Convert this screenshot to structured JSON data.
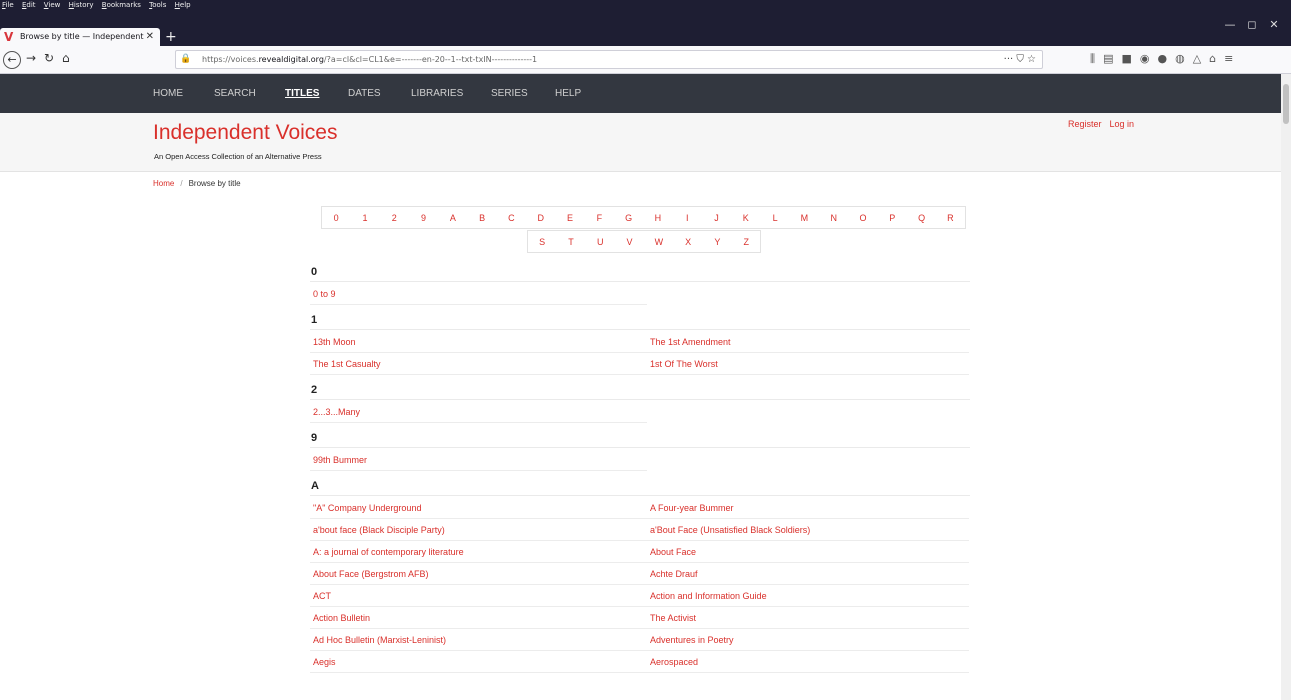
{
  "browser": {
    "menu": [
      "File",
      "Edit",
      "View",
      "History",
      "Bookmarks",
      "Tools",
      "Help"
    ],
    "tab_title": "Browse by title — Independent",
    "url_prefix": "https://voices.",
    "url_domain": "revealdigital.org",
    "url_rest": "/?a=cl&cl=CL1&e=-------en-20--1--txt-txIN--------------1",
    "url_actions": "··· ⛉ ☆",
    "window_controls": [
      "—",
      "◻",
      "✕"
    ]
  },
  "site_nav": [
    "HOME",
    "SEARCH",
    "TITLES",
    "DATES",
    "LIBRARIES",
    "SERIES",
    "HELP"
  ],
  "brand": {
    "title": "Independent Voices",
    "subtitle": "An Open Access Collection of an Alternative Press"
  },
  "auth": {
    "register": "Register",
    "login": "Log in"
  },
  "breadcrumb": {
    "home": "Home",
    "sep": "/",
    "current": "Browse by title"
  },
  "alphabet_row1": [
    "0",
    "1",
    "2",
    "9",
    "A",
    "B",
    "C",
    "D",
    "E",
    "F",
    "G",
    "H",
    "I",
    "J",
    "K",
    "L",
    "M",
    "N",
    "O",
    "P",
    "Q",
    "R"
  ],
  "alphabet_row2": [
    "S",
    "T",
    "U",
    "V",
    "W",
    "X",
    "Y",
    "Z"
  ],
  "sections": [
    {
      "heading": "0",
      "titles": [
        "0 to 9"
      ]
    },
    {
      "heading": "1",
      "titles": [
        "13th Moon",
        "The 1st Amendment",
        "The 1st Casualty",
        "1st Of The Worst"
      ]
    },
    {
      "heading": "2",
      "titles": [
        "2...3...Many"
      ]
    },
    {
      "heading": "9",
      "titles": [
        "99th Bummer"
      ]
    },
    {
      "heading": "A",
      "titles": [
        "\"A\" Company Underground",
        "A Four-year Bummer",
        "a'bout face (Black Disciple Party)",
        "a'Bout Face (Unsatisfied Black Soldiers)",
        "A: a journal of contemporary literature",
        "About Face",
        "About Face (Bergstrom AFB)",
        "Achte Drauf",
        "ACT",
        "Action and Information Guide",
        "Action Bulletin",
        "The Activist",
        "Ad Hoc Bulletin (Marxist-Leninist)",
        "Adventures in Poetry",
        "Aegis",
        "Aerospaced"
      ]
    }
  ]
}
